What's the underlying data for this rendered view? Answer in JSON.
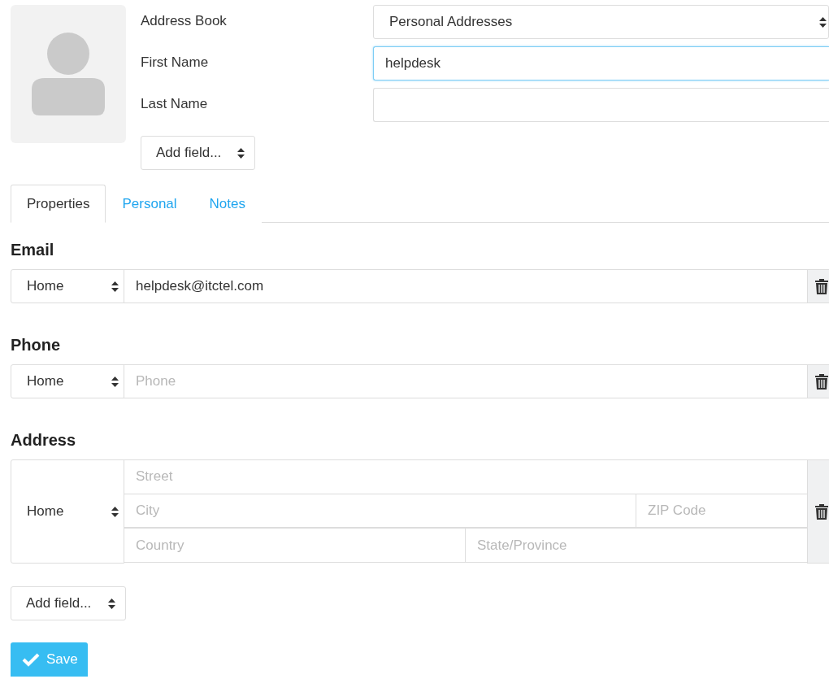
{
  "contact": {
    "address_book": {
      "label": "Address Book",
      "value": "Personal Addresses"
    },
    "first_name": {
      "label": "First Name",
      "value": "helpdesk",
      "focused": true
    },
    "last_name": {
      "label": "Last Name",
      "focused": false
    },
    "add_field": "Add field..."
  },
  "tabs": [
    {
      "label": "Properties",
      "selected": true
    },
    {
      "label": "Personal",
      "selected": false
    },
    {
      "label": "Notes",
      "selected": false
    }
  ],
  "sections": [
    {
      "kind": "email",
      "title": "Email",
      "type": "Home",
      "value": "helpdesk@itctel.com"
    },
    {
      "kind": "phone",
      "title": "Phone",
      "type": "Home",
      "placeholder": "Phone"
    },
    {
      "kind": "address",
      "title": "Address",
      "type": "Home",
      "street_placeholder": "Street",
      "city_placeholder": "City",
      "zip_placeholder": "ZIP Code",
      "country_placeholder": "Country",
      "state_placeholder": "State/Province"
    }
  ],
  "add_field": "Add field...",
  "save_button": "Save"
}
